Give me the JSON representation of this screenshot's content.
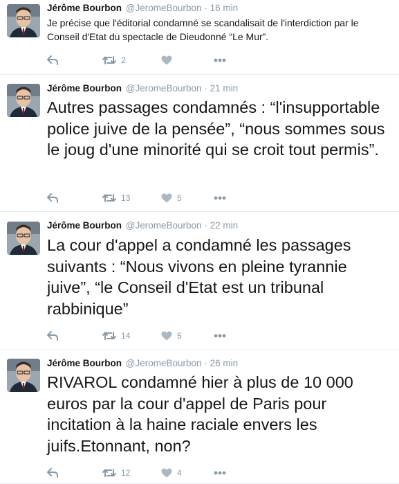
{
  "tweets": [
    {
      "name": "Jérôme Bourbon",
      "handle": "@JeromeBourbon",
      "separator": "·",
      "time": "16 min",
      "text": "Je précise que l'éditorial condamné se scandalisait de l'interdiction par le Conseil d'Etat du spectacle de Dieudonné “Le Mur”.",
      "retweets": "2",
      "likes": ""
    },
    {
      "name": "Jérôme Bourbon",
      "handle": "@JeromeBourbon",
      "separator": "·",
      "time": "21 min",
      "text": "Autres passages condamnés : “l'insupportable police juive de la pensée”, “nous sommes sous le joug d'une minorité qui se croit tout permis”.",
      "retweets": "13",
      "likes": "5"
    },
    {
      "name": "Jérôme Bourbon",
      "handle": "@JeromeBourbon",
      "separator": "·",
      "time": "22 min",
      "text": "La cour d'appel a condamné les passages suivants : “Nous vivons en pleine tyrannie juive”, “le Conseil d'Etat est un tribunal rabbinique”",
      "retweets": "14",
      "likes": "5"
    },
    {
      "name": "Jérôme Bourbon",
      "handle": "@JeromeBourbon",
      "separator": "·",
      "time": "26 min",
      "text": "RIVAROL condamné hier à plus de 10 000 euros par la cour d'appel de Paris pour incitation à la haine raciale envers les juifs.Etonnant, non?",
      "retweets": "12",
      "likes": "4"
    }
  ],
  "colors": {
    "meta": "#8899a6",
    "text": "#14171a",
    "divider": "#e6ecf0"
  },
  "icons": [
    "reply-icon",
    "retweet-icon",
    "like-icon",
    "more-icon"
  ]
}
